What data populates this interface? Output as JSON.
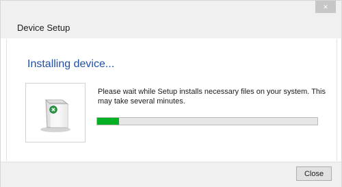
{
  "window": {
    "close_glyph": "×",
    "title": "Device Setup"
  },
  "content": {
    "heading": "Installing device...",
    "message": "Please wait while Setup installs necessary files on your system. This may take several minutes.",
    "progress_fraction": 0.1
  },
  "footer": {
    "close_label": "Close"
  },
  "icons": {
    "device": "device-icon",
    "window_close": "close-icon"
  },
  "colors": {
    "heading": "#1f4fa6",
    "progress": "#06b025"
  }
}
